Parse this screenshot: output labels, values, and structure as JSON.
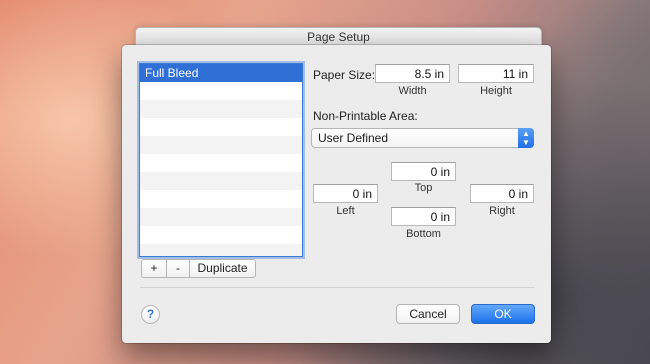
{
  "window": {
    "title": "Page Setup"
  },
  "sidebar": {
    "items": [
      {
        "label": "Full Bleed",
        "selected": true
      }
    ],
    "add_label": "+",
    "remove_label": "-",
    "duplicate_label": "Duplicate"
  },
  "paper_size": {
    "label": "Paper Size:",
    "width_value": "8.5 in",
    "width_caption": "Width",
    "height_value": "11 in",
    "height_caption": "Height"
  },
  "non_printable": {
    "label": "Non-Printable Area:",
    "selected": "User Defined",
    "top_value": "0 in",
    "top_caption": "Top",
    "left_value": "0 in",
    "left_caption": "Left",
    "right_value": "0 in",
    "right_caption": "Right",
    "bottom_value": "0 in",
    "bottom_caption": "Bottom"
  },
  "footer": {
    "help_label": "?",
    "cancel_label": "Cancel",
    "ok_label": "OK"
  },
  "colors": {
    "accent": "#2f6fd6",
    "ok_button": "#1c71ea"
  }
}
